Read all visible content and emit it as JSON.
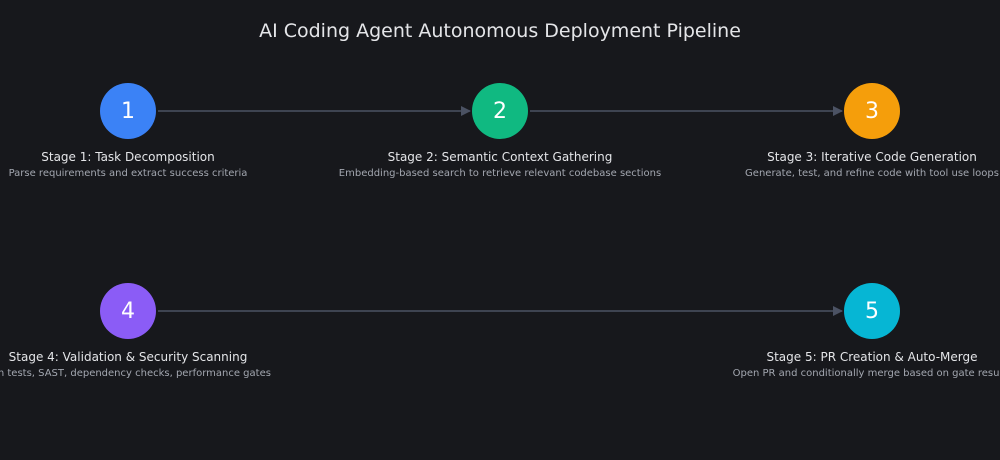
{
  "title": "AI Coding Agent Autonomous Deployment Pipeline",
  "stages": [
    {
      "number": "1",
      "name": "Stage 1: Task Decomposition",
      "description": "Parse requirements and extract success criteria",
      "color": "#3b82f6"
    },
    {
      "number": "2",
      "name": "Stage 2: Semantic Context Gathering",
      "description": "Embedding-based search to retrieve relevant codebase sections",
      "color": "#10b981"
    },
    {
      "number": "3",
      "name": "Stage 3: Iterative Code Generation",
      "description": "Generate, test, and refine code with tool use loops",
      "color": "#f59e0b"
    },
    {
      "number": "4",
      "name": "Stage 4: Validation & Security Scanning",
      "description": "Run tests, SAST, dependency checks, performance gates",
      "color": "#8b5cf6"
    },
    {
      "number": "5",
      "name": "Stage 5: PR Creation & Auto-Merge",
      "description": "Open PR and conditionally merge based on gate results",
      "color": "#06b6d4"
    }
  ],
  "connector_color": "#4b5263"
}
